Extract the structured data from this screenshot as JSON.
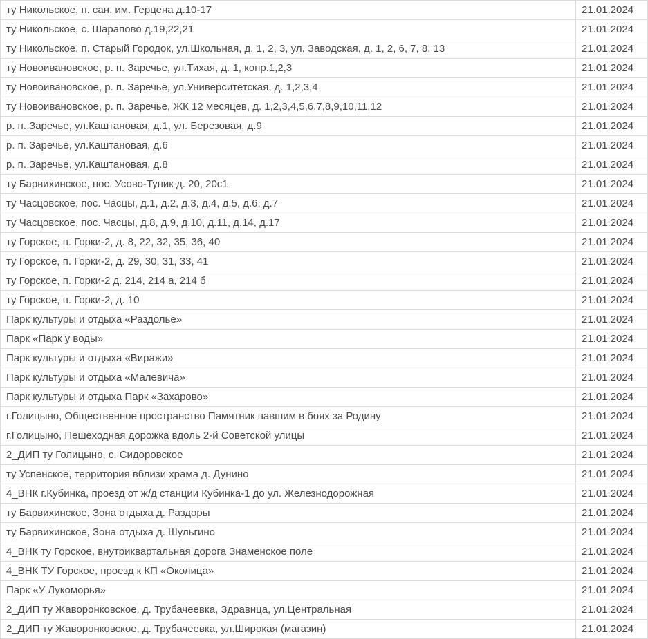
{
  "rows": [
    {
      "address": "ту Никольское, п. сан. им. Герцена д.10-17",
      "date": "21.01.2024"
    },
    {
      "address": "ту Никольское, с. Шарапово д.19,22,21",
      "date": "21.01.2024"
    },
    {
      "address": "ту Никольское, п. Старый Городок, ул.Школьная, д. 1, 2, 3, ул. Заводская, д. 1, 2, 6, 7, 8, 13",
      "date": "21.01.2024"
    },
    {
      "address": "ту Новоивановское, р. п. Заречье, ул.Тихая, д. 1, копр.1,2,3",
      "date": "21.01.2024"
    },
    {
      "address": "ту Новоивановское, р. п. Заречье, ул.Университетская, д. 1,2,3,4",
      "date": "21.01.2024"
    },
    {
      "address": "ту Новоивановское, р. п. Заречье, ЖК 12 месяцев, д. 1,2,3,4,5,6,7,8,9,10,11,12",
      "date": "21.01.2024"
    },
    {
      "address": "р. п. Заречье, ул.Каштановая, д.1, ул. Березовая, д.9",
      "date": "21.01.2024"
    },
    {
      "address": "р. п. Заречье, ул.Каштановая, д.6",
      "date": "21.01.2024"
    },
    {
      "address": "р. п. Заречье, ул.Каштановая, д.8",
      "date": "21.01.2024"
    },
    {
      "address": "ту Барвихинское, пос. Усово-Тупик д. 20, 20с1",
      "date": "21.01.2024"
    },
    {
      "address": "ту Часцовское, пос. Часцы, д.1, д.2, д.3, д.4, д.5, д.6, д.7",
      "date": "21.01.2024"
    },
    {
      "address": "ту Часцовское, пос. Часцы, д.8, д.9, д.10, д.11, д.14, д.17",
      "date": "21.01.2024"
    },
    {
      "address": "ту Горское, п. Горки-2, д. 8, 22, 32, 35, 36, 40",
      "date": "21.01.2024"
    },
    {
      "address": "ту Горское, п. Горки-2, д. 29, 30, 31, 33, 41",
      "date": "21.01.2024"
    },
    {
      "address": "ту Горское, п. Горки-2 д. 214, 214 а, 214 б",
      "date": "21.01.2024"
    },
    {
      "address": "ту Горское, п. Горки-2, д. 10",
      "date": "21.01.2024"
    },
    {
      "address": "Парк культуры и отдыха «Раздолье»",
      "date": "21.01.2024"
    },
    {
      "address": "Парк «Парк у воды»",
      "date": "21.01.2024"
    },
    {
      "address": "Парк культуры и отдыха «Виражи»",
      "date": "21.01.2024"
    },
    {
      "address": "Парк культуры и отдыха «Малевича»",
      "date": "21.01.2024"
    },
    {
      "address": "Парк культуры и отдыха Парк «Захарово»",
      "date": "21.01.2024"
    },
    {
      "address": "г.Голицыно, Общественное пространство Памятник павшим в боях за Родину",
      "date": "21.01.2024"
    },
    {
      "address": "г.Голицыно, Пешеходная дорожка вдоль 2-й Советской улицы",
      "date": "21.01.2024"
    },
    {
      "address": "2_ДИП ту Голицыно, с. Сидоровское",
      "date": "21.01.2024"
    },
    {
      "address": "ту Успенское, территория вблизи храма д. Дунино",
      "date": "21.01.2024"
    },
    {
      "address": "4_ВНК г.Кубинка, проезд от ж/д станции Кубинка-1 до ул. Железнодорожная",
      "date": "21.01.2024"
    },
    {
      "address": "ту Барвихинское, Зона отдыха д. Раздоры",
      "date": "21.01.2024"
    },
    {
      "address": "ту Барвихинское, Зона отдыха д. Шульгино",
      "date": "21.01.2024"
    },
    {
      "address": "4_ВНК ту Горское, внутриквартальная дорога Знаменское поле",
      "date": "21.01.2024"
    },
    {
      "address": "4_ВНК ТУ Горское, проезд к КП «Околица»",
      "date": "21.01.2024"
    },
    {
      "address": "Парк «У Лукоморья»",
      "date": "21.01.2024"
    },
    {
      "address": "2_ДИП ту Жаворонковское, д. Трубачеевка, Здравнца, ул.Центральная",
      "date": "21.01.2024"
    },
    {
      "address": "2_ДИП ту Жаворонковское, д. Трубачеевка, ул.Широкая (магазин)",
      "date": "21.01.2024"
    }
  ]
}
